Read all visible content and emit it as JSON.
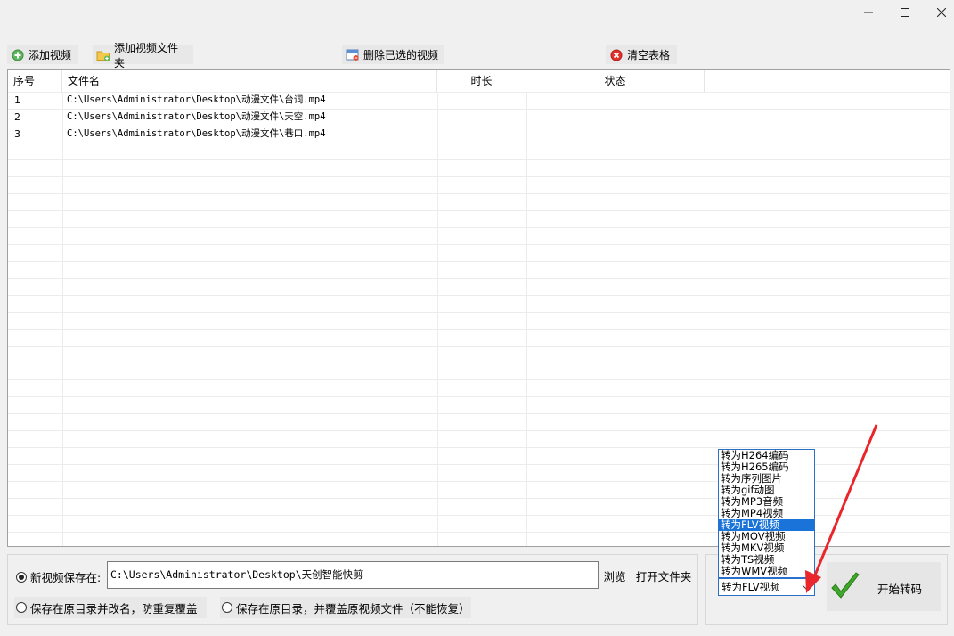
{
  "window": {
    "minimize_symbol": "–",
    "maximize_symbol": "□",
    "close_symbol": "×"
  },
  "toolbar": {
    "add_video": "添加视频",
    "add_folder": "添加视频文件夹",
    "delete_selected": "删除已选的视频",
    "clear_table": "清空表格"
  },
  "table": {
    "headers": {
      "index": "序号",
      "filename": "文件名",
      "duration": "时长",
      "status": "状态"
    },
    "rows": [
      {
        "index": "1",
        "filename": "C:\\Users\\Administrator\\Desktop\\动漫文件\\台词.mp4",
        "duration": "",
        "status": ""
      },
      {
        "index": "2",
        "filename": "C:\\Users\\Administrator\\Desktop\\动漫文件\\天空.mp4",
        "duration": "",
        "status": ""
      },
      {
        "index": "3",
        "filename": "C:\\Users\\Administrator\\Desktop\\动漫文件\\巷口.mp4",
        "duration": "",
        "status": ""
      }
    ]
  },
  "output": {
    "save_to_label": "新视频保存在:",
    "save_path": "C:\\Users\\Administrator\\Desktop\\天创智能快剪",
    "browse": "浏览",
    "open_folder": "打开文件夹",
    "option_rename": "保存在原目录并改名，防重复覆盖",
    "option_overwrite": "保存在原目录，并覆盖原视频文件（不能恢复）"
  },
  "format": {
    "options": [
      "转为H264编码",
      "转为H265编码",
      "转为序列图片",
      "转为gif动图",
      "转为MP3音频",
      "转为MP4视频",
      "转为FLV视频",
      "转为MOV视频",
      "转为MKV视频",
      "转为TS视频",
      "转为WMV视频"
    ],
    "selected": "转为FLV视频"
  },
  "start_button": "开始转码",
  "colors": {
    "accent": "#1a73d8",
    "arrow": "#e8262b",
    "check": "#3fa82a"
  }
}
